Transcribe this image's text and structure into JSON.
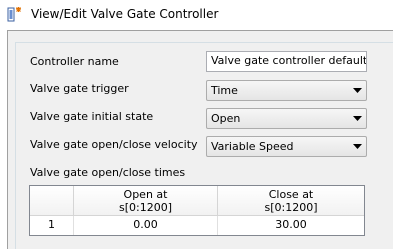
{
  "window": {
    "title": "View/Edit Valve Gate Controller",
    "icon": "controller-app-icon"
  },
  "form": {
    "controller_name_label": "Controller name",
    "controller_name_value": "Valve gate controller defaults",
    "trigger_label": "Valve gate trigger",
    "trigger_value": "Time",
    "initial_state_label": "Valve gate initial state",
    "initial_state_value": "Open",
    "velocity_label": "Valve gate open/close velocity",
    "velocity_value": "Variable Speed",
    "times_label": "Valve gate open/close times"
  },
  "times_table": {
    "columns": [
      {
        "line1": "Open at",
        "line2": "s[0:1200]"
      },
      {
        "line1": "Close at",
        "line2": "s[0:1200]"
      }
    ],
    "rows": [
      {
        "index": "1",
        "open_at": "0.00",
        "close_at": "30.00"
      }
    ]
  }
}
